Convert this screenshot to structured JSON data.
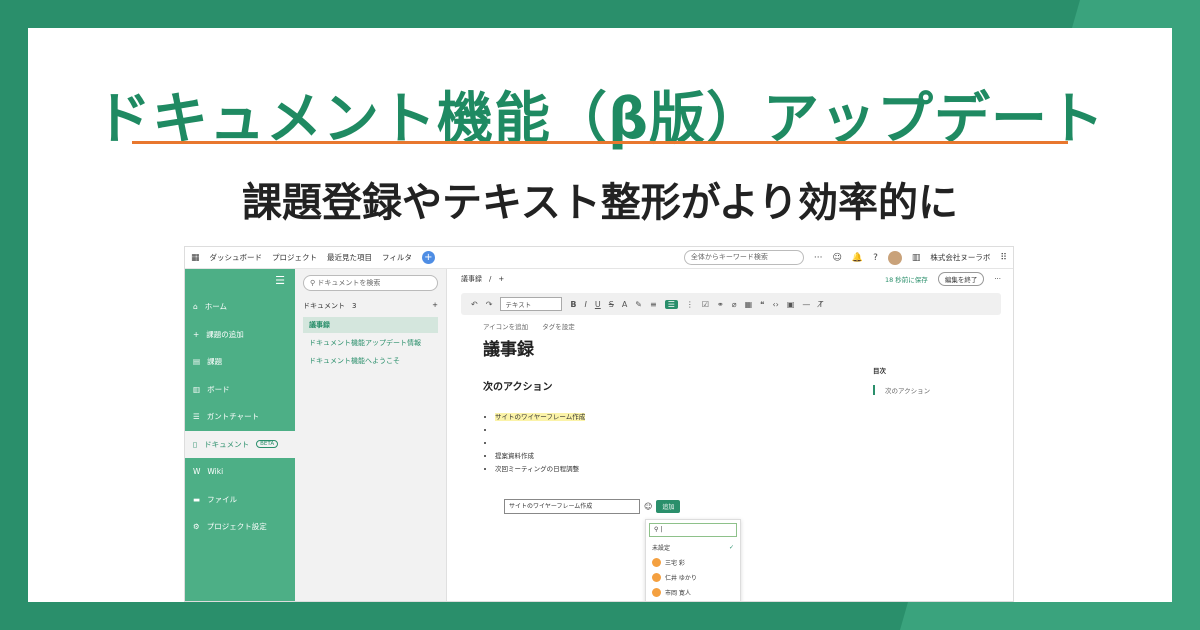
{
  "banner": {
    "title": "ドキュメント機能（β版）アップデート",
    "subtitle": "課題登録やテキスト整形がより効率的に"
  },
  "topbar": {
    "nav": [
      "ダッシュボード",
      "プロジェクト",
      "最近見た項目",
      "フィルタ"
    ],
    "search_placeholder": "全体からキーワード検索",
    "org": "株式会社ヌーラボ"
  },
  "sidebar": {
    "items": [
      {
        "label": "ホーム",
        "icon": "home-icon"
      },
      {
        "label": "課題の追加",
        "icon": "plus-icon"
      },
      {
        "label": "課題",
        "icon": "list-icon"
      },
      {
        "label": "ボード",
        "icon": "board-icon"
      },
      {
        "label": "ガントチャート",
        "icon": "gantt-icon"
      },
      {
        "label": "ドキュメント",
        "icon": "document-icon",
        "badge": "BETA"
      },
      {
        "label": "Wiki",
        "icon": "wiki-icon"
      },
      {
        "label": "ファイル",
        "icon": "file-icon"
      },
      {
        "label": "プロジェクト設定",
        "icon": "gear-icon"
      }
    ]
  },
  "tree": {
    "search_placeholder": "ドキュメントを検索",
    "header": "ドキュメント",
    "count": "3",
    "docs": [
      "議事録",
      "ドキュメント機能アップデート情報",
      "ドキュメント機能へようこそ"
    ]
  },
  "editor": {
    "breadcrumb": "議事録　/　+",
    "save_status": "18 秒前に保存",
    "end_edit": "編集を終了",
    "style_select": "テキスト",
    "add_icon": "アイコンを追加",
    "set_tag": "タグを設定",
    "heading1": "議事録",
    "heading2": "次のアクション",
    "list": [
      "サイトのワイヤーフレーム作成",
      "",
      "",
      "提案資料作成",
      "次回ミーティングの日程調整"
    ],
    "popup_input": "サイトのワイヤーフレーム作成",
    "popup_add": "追加",
    "assignees": [
      "未設定",
      "三宅 彩",
      "仁井 ゆかり",
      "市岡 寛人"
    ],
    "toc_title": "目次",
    "toc_entry": "次のアクション"
  }
}
